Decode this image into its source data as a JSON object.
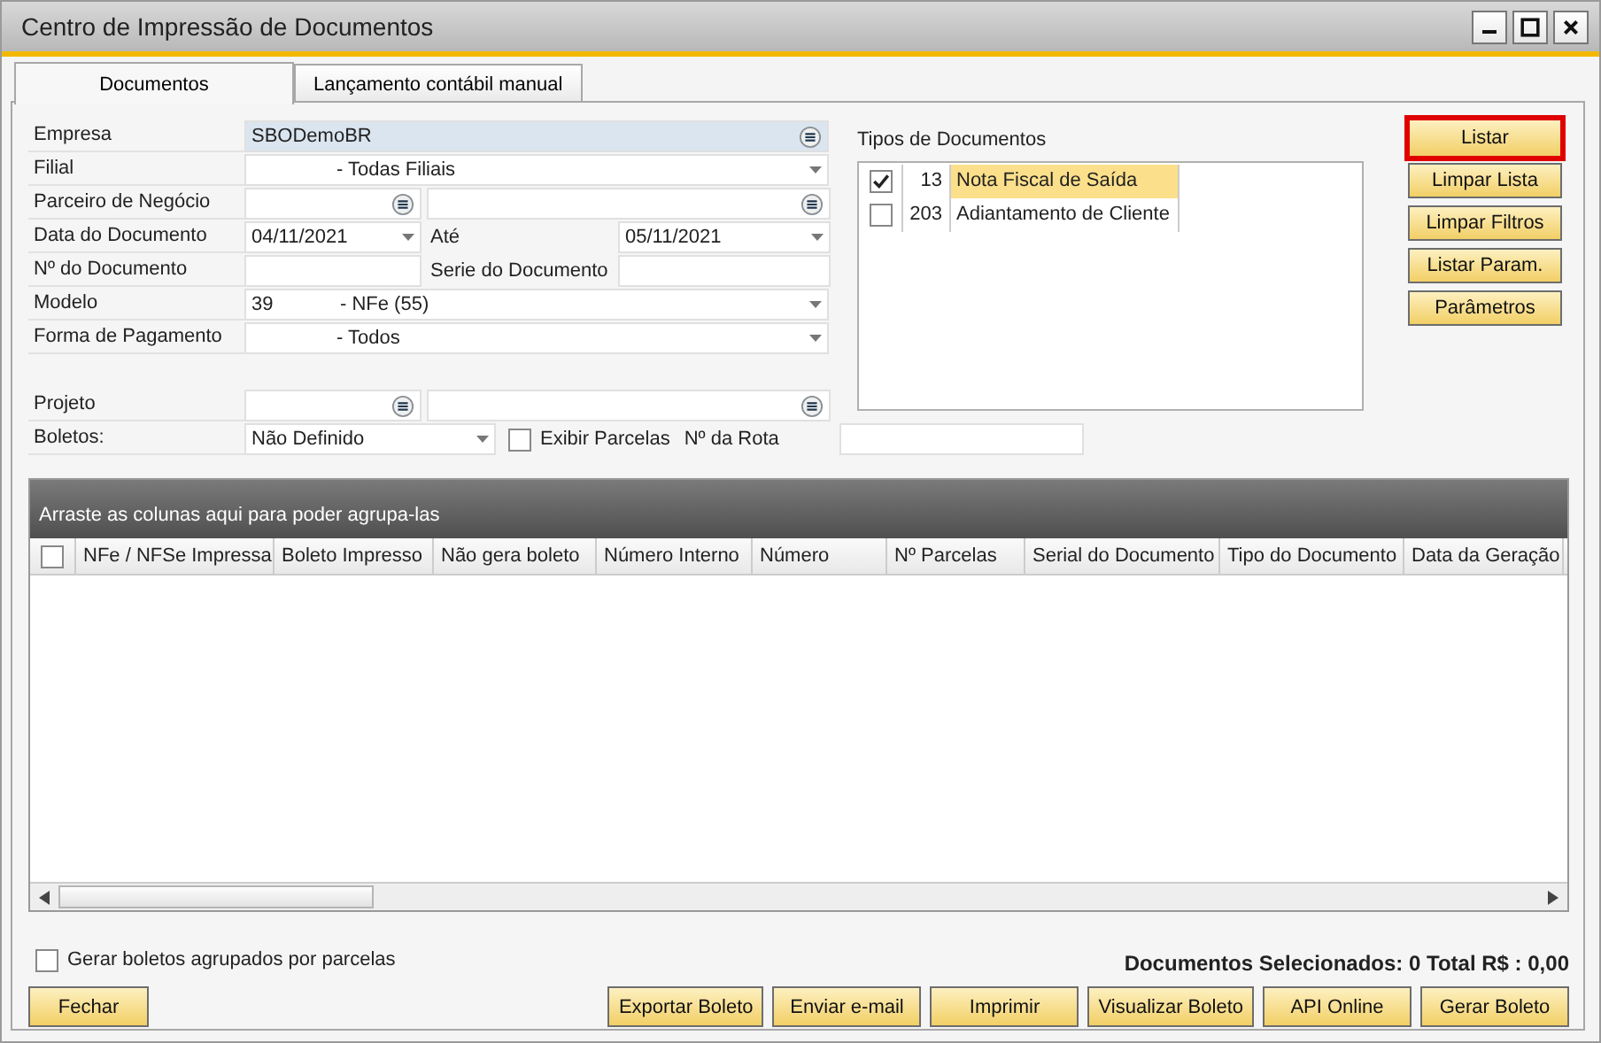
{
  "window": {
    "title": "Centro de Impressão de Documentos"
  },
  "tabs": [
    {
      "label": "Documentos",
      "selected": true
    },
    {
      "label": "Lançamento contábil manual",
      "selected": false
    }
  ],
  "form": {
    "company": {
      "label": "Empresa",
      "value": "SBODemoBR"
    },
    "branch": {
      "label": "Filial",
      "value": "- Todas Filiais"
    },
    "partner": {
      "label": "Parceiro de Negócio"
    },
    "doc_date": {
      "label": "Data do Documento",
      "from": "04/11/2021",
      "to_label": "Até",
      "to": "05/11/2021"
    },
    "doc_number": {
      "label": "Nº do Documento",
      "series_label": "Serie do Documento"
    },
    "model": {
      "label": "Modelo",
      "code": "39",
      "value": "- NFe (55)"
    },
    "payment": {
      "label": "Forma de Pagamento",
      "value": "- Todos"
    },
    "project": {
      "label": "Projeto"
    },
    "boletos": {
      "label": "Boletos:",
      "value": "Não Definido",
      "show_installments": {
        "label": "Exibir Parcelas",
        "checked": false
      },
      "route_label": "Nº da Rota"
    }
  },
  "doc_types": {
    "title": "Tipos de Documentos",
    "items": [
      {
        "code": "13",
        "name": "Nota Fiscal de Saída",
        "checked": true,
        "selected": true
      },
      {
        "code": "203",
        "name": "Adiantamento de Cliente",
        "checked": false,
        "selected": false
      }
    ]
  },
  "side_buttons": [
    {
      "label": "Listar",
      "focused": true
    },
    {
      "label": "Limpar Lista",
      "focused": false
    },
    {
      "label": "Limpar Filtros",
      "focused": false
    },
    {
      "label": "Listar Param.",
      "focused": false
    },
    {
      "label": "Parâmetros",
      "focused": false
    }
  ],
  "grid": {
    "group_hint": "Arraste as colunas aqui para poder agrupa-las",
    "select_all_checked": false,
    "columns": [
      "NFe / NFSe Impressa",
      "Boleto Impresso",
      "Não gera boleto",
      "Número Interno",
      "Número",
      "Nº Parcelas",
      "Serial do Documento",
      "Tipo do Documento",
      "Data da Geração"
    ]
  },
  "group_by_installments": {
    "label": "Gerar boletos agrupados por parcelas",
    "checked": false
  },
  "summary": "Documentos Selecionados: 0 Total R$ :  0,00",
  "close_button": "Fechar",
  "action_buttons": [
    "Exportar Boleto",
    "Enviar e-mail",
    "Imprimir",
    "Visualizar Boleto",
    "API Online",
    "Gerar Boleto"
  ]
}
